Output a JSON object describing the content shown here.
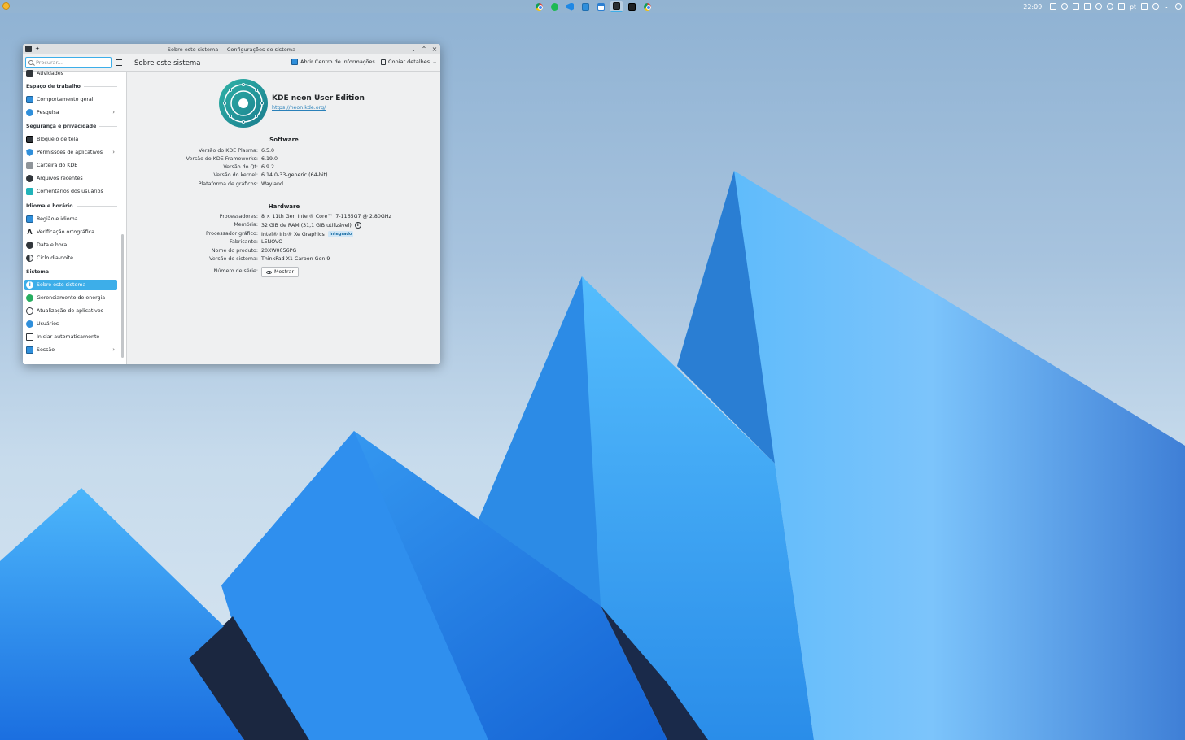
{
  "panel": {
    "clock": "22:09",
    "language": "pt",
    "tasks": [
      "chrome-icon",
      "spotify-icon",
      "vscode-icon",
      "window-icon",
      "calendar-icon",
      "settings-icon",
      "terminal-icon",
      "chrome-icon"
    ]
  },
  "window": {
    "title": "Sobre este sistema — Configurações do sistema"
  },
  "toolbar": {
    "search_placeholder": "Procurar...",
    "page_title": "Sobre este sistema",
    "info_center_label": "Abrir Centro de informações...",
    "copy_details_label": "Copiar detalhes"
  },
  "sidebar": {
    "items_top": [
      {
        "label": "Atividades"
      }
    ],
    "workspace": {
      "heading": "Espaço de trabalho",
      "items": [
        {
          "label": "Comportamento geral"
        },
        {
          "label": "Pesquisa"
        }
      ]
    },
    "security": {
      "heading": "Segurança e privacidade",
      "items": [
        {
          "label": "Bloqueio de tela"
        },
        {
          "label": "Permissões de aplicativos"
        },
        {
          "label": "Carteira do KDE"
        },
        {
          "label": "Arquivos recentes"
        },
        {
          "label": "Comentários dos usuários"
        }
      ]
    },
    "language": {
      "heading": "Idioma e horário",
      "items": [
        {
          "label": "Região e idioma"
        },
        {
          "label": "Verificação ortográfica"
        },
        {
          "label": "Data e hora"
        },
        {
          "label": "Ciclo dia-noite"
        }
      ]
    },
    "system": {
      "heading": "Sistema",
      "items": [
        {
          "label": "Sobre este sistema"
        },
        {
          "label": "Gerenciamento de energia"
        },
        {
          "label": "Atualização de aplicativos"
        },
        {
          "label": "Usuários"
        },
        {
          "label": "Iniciar automaticamente"
        },
        {
          "label": "Sessão"
        }
      ]
    }
  },
  "about": {
    "distro_name": "KDE neon User Edition",
    "distro_url": "https://neon.kde.org/",
    "software": {
      "heading": "Software",
      "rows": [
        {
          "key": "Versão do KDE Plasma:",
          "value": "6.5.0"
        },
        {
          "key": "Versão do KDE Frameworks:",
          "value": "6.19.0"
        },
        {
          "key": "Versão do Qt:",
          "value": "6.9.2"
        },
        {
          "key": "Versão do kernel:",
          "value": "6.14.0-33-generic (64-bit)"
        },
        {
          "key": "Plataforma de gráficos:",
          "value": "Wayland"
        }
      ]
    },
    "hardware": {
      "heading": "Hardware",
      "rows": [
        {
          "key": "Processadores:",
          "value": "8 × 11th Gen Intel® Core™ i7-1165G7 @ 2.80GHz"
        },
        {
          "key": "Memória:",
          "value": "32 GiB de RAM (31,1 GiB utilizável)"
        },
        {
          "key": "Processador gráfico:",
          "value": "Intel® Iris® Xe Graphics",
          "badge": "Integrado"
        },
        {
          "key": "Fabricante:",
          "value": "LENOVO"
        },
        {
          "key": "Nome do produto:",
          "value": "20XW0056PG"
        },
        {
          "key": "Versão do sistema:",
          "value": "ThinkPad X1 Carbon Gen 9"
        },
        {
          "key": "Número de série:",
          "button": "Mostrar"
        }
      ]
    }
  },
  "colors": {
    "accent": "#3daee9",
    "link": "#2980b9",
    "window_bg": "#eff0f1"
  }
}
